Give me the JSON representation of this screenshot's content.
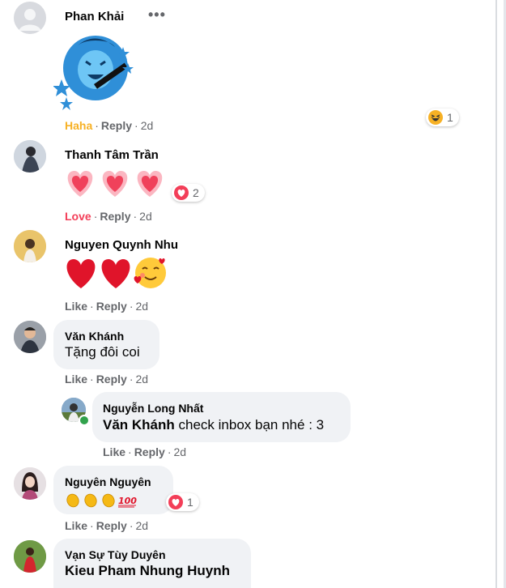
{
  "comments": [
    {
      "author": "Phan Khải",
      "more_label": "•••",
      "reaction_label": "Haha",
      "reply_label": "Reply",
      "time": "2d",
      "reaction_count": "1"
    },
    {
      "author": "Thanh Tâm Trần",
      "reaction_label": "Love",
      "reply_label": "Reply",
      "time": "2d",
      "reaction_count": "2"
    },
    {
      "author": "Nguyen Quynh Nhu",
      "reaction_label": "Like",
      "reply_label": "Reply",
      "time": "2d"
    },
    {
      "author": "Văn Khánh",
      "text": "Tặng đôi coi",
      "reaction_label": "Like",
      "reply_label": "Reply",
      "time": "2d",
      "reply": {
        "author": "Nguyễn Long Nhất",
        "tag": "Văn Khánh",
        "text": " check inbox bạn nhé : 3",
        "reaction_label": "Like",
        "reply_label": "Reply",
        "time": "2d"
      }
    },
    {
      "author": "Nguyên Nguyên",
      "emoji_text": "👏👏👏💯",
      "reaction_label": "Like",
      "reply_label": "Reply",
      "time": "2d",
      "reaction_count": "1"
    },
    {
      "author": "Vạn Sự Tùy Duyên",
      "tag": "Kieu Pham Nhung Huynh"
    }
  ],
  "separator": "·",
  "colors": {
    "haha": "#f7b125",
    "love": "#f33e58",
    "meta": "#65676b",
    "bubble": "#f0f2f5",
    "online": "#31a24c"
  }
}
